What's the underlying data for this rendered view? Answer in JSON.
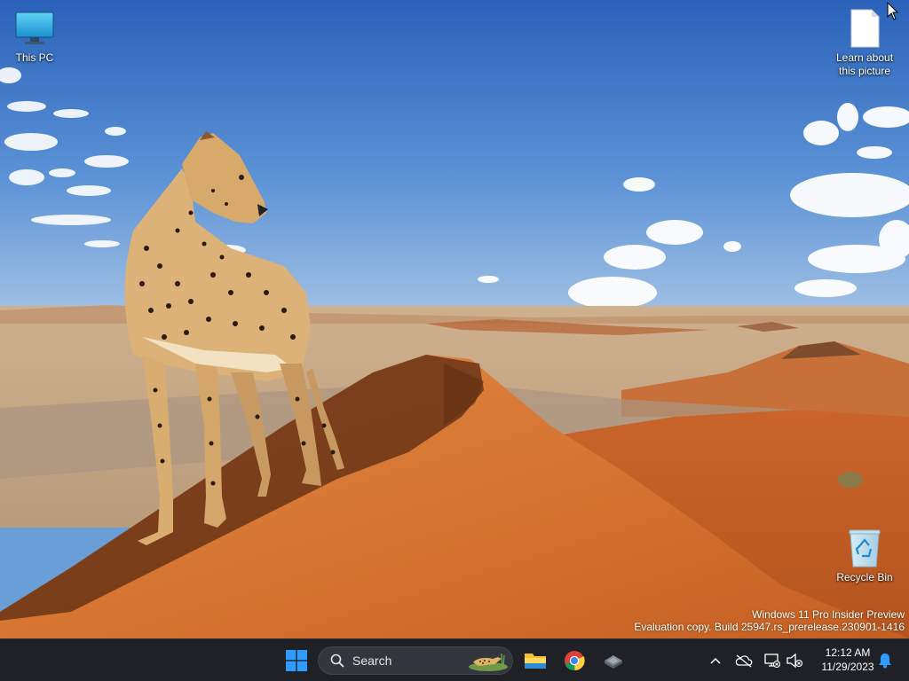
{
  "desktop": {
    "icons": [
      {
        "label": "This PC",
        "icon": "monitor-icon"
      },
      {
        "label": "Learn about this picture",
        "icon": "document-icon"
      },
      {
        "label": "Recycle Bin",
        "icon": "recycle-bin-icon"
      }
    ],
    "watermark": {
      "line1": "Windows 11 Pro Insider Preview",
      "line2": "Evaluation copy. Build 25947.rs_prerelease.230901-1416"
    }
  },
  "taskbar": {
    "start_icon": "windows-logo-icon",
    "search": {
      "placeholder": "Search",
      "icon": "search-icon"
    },
    "apps": [
      {
        "name": "File Explorer",
        "icon": "folder-icon"
      },
      {
        "name": "Google Chrome",
        "icon": "chrome-icon"
      },
      {
        "name": "App",
        "icon": "dropbox-like-icon"
      }
    ],
    "tray": {
      "icons": [
        "chevron-up-icon",
        "onedrive-offline-icon",
        "network-disconnected-icon",
        "volume-muted-icon"
      ],
      "time": "12:12 AM",
      "date": "11/29/2023",
      "notification_icon": "bell-icon"
    }
  },
  "colors": {
    "taskbar_bg": "#1f2127",
    "accent_blue": "#2f9bff",
    "sky_top": "#2e69c0",
    "sand": "#d6732f"
  }
}
